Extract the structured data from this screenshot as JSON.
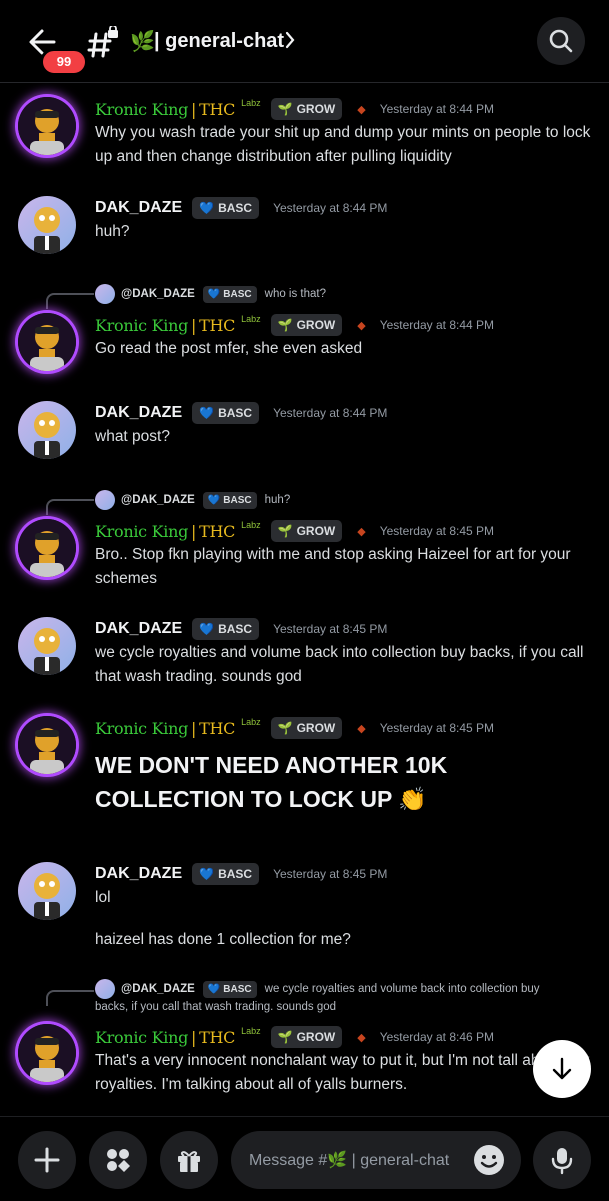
{
  "header": {
    "back_badge": "99",
    "leaf": "🌿",
    "channel_name": "| general-chat"
  },
  "users": {
    "kronic": {
      "name_a": "Kronic King",
      "sep": "|",
      "name_b": "THC",
      "labz": "Labz",
      "tag_icon": "🌱",
      "tag": "GROW"
    },
    "dak": {
      "name": "DAK_DAZE",
      "tag_icon": "💙",
      "tag": "BASC"
    }
  },
  "messages": [
    {
      "author": "Kronic King | THC",
      "time": "Yesterday at 8:44 PM",
      "text": "Why you wash trade your shit up and dump your mints on people to lock up and then change distribution after pulling liquidity"
    },
    {
      "author": "DAK_DAZE",
      "time": "Yesterday at 8:44 PM",
      "text": "huh?"
    },
    {
      "author": "Kronic King | THC",
      "time": "Yesterday at 8:44 PM",
      "reply_to": {
        "name": "@DAK_DAZE",
        "tag": "BASC",
        "text": "who is that?"
      },
      "text": "Go read the post mfer, she even asked"
    },
    {
      "author": "DAK_DAZE",
      "time": "Yesterday at 8:44 PM",
      "text": "what post?"
    },
    {
      "author": "Kronic King | THC",
      "time": "Yesterday at 8:45 PM",
      "reply_to": {
        "name": "@DAK_DAZE",
        "tag": "BASC",
        "text": "huh?"
      },
      "text": "Bro.. Stop fkn playing with me and stop asking Haizeel for art for your schemes"
    },
    {
      "author": "DAK_DAZE",
      "time": "Yesterday at 8:45 PM",
      "text": "we cycle royalties and volume back into collection buy backs, if you call that wash trading. sounds god"
    },
    {
      "author": "Kronic King | THC",
      "time": "Yesterday at 8:45 PM",
      "text": "WE DON'T NEED ANOTHER 10K COLLECTION TO LOCK UP 👏"
    },
    {
      "author": "DAK_DAZE",
      "time": "Yesterday at 8:45 PM",
      "text": "lol",
      "text2": "haizeel has done 1 collection for me?"
    },
    {
      "author": "Kronic King | THC",
      "time": "Yesterday at 8:46 PM",
      "reply_to": {
        "name": "@DAK_DAZE",
        "tag": "BASC",
        "text": "we cycle royalties and volume back into collection buy backs, if you call that wash trading. sounds god"
      },
      "text": "That's a very innocent nonchalant way to put it, but I'm not tall about just royalties. I'm talking about all of yalls burners."
    }
  ],
  "composer": {
    "placeholder": "Message #🌿 | general-chat"
  }
}
